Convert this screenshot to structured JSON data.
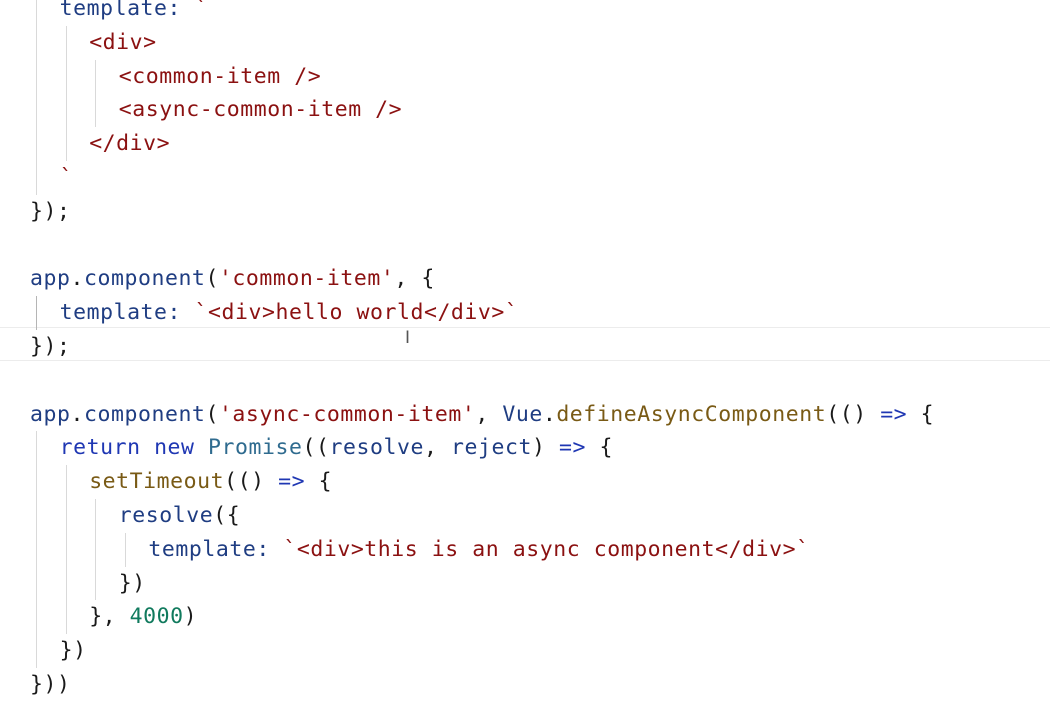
{
  "editor": {
    "language": "javascript",
    "lines": [
      {
        "indent": 1,
        "tokens": [
          {
            "t": "template: ",
            "k": "prop"
          },
          {
            "t": "`",
            "k": "str"
          }
        ]
      },
      {
        "indent": 2,
        "tokens": [
          {
            "t": "<div>",
            "k": "tag"
          }
        ]
      },
      {
        "indent": 3,
        "tokens": [
          {
            "t": "<common-item />",
            "k": "tag"
          }
        ]
      },
      {
        "indent": 3,
        "tokens": [
          {
            "t": "<async-common-item />",
            "k": "tag"
          }
        ]
      },
      {
        "indent": 2,
        "tokens": [
          {
            "t": "</div>",
            "k": "tag"
          }
        ]
      },
      {
        "indent": 1,
        "tokens": [
          {
            "t": "`",
            "k": "str"
          }
        ]
      },
      {
        "indent": 0,
        "tokens": [
          {
            "t": "});",
            "k": "punc"
          }
        ]
      },
      {
        "indent": 0,
        "tokens": []
      },
      {
        "indent": 0,
        "tokens": [
          {
            "t": "app",
            "k": "prop"
          },
          {
            "t": ".",
            "k": "punc"
          },
          {
            "t": "component",
            "k": "prop"
          },
          {
            "t": "(",
            "k": "punc"
          },
          {
            "t": "'common-item'",
            "k": "str"
          },
          {
            "t": ", {",
            "k": "punc"
          }
        ]
      },
      {
        "indent": 1,
        "tokens": [
          {
            "t": "template: ",
            "k": "prop"
          },
          {
            "t": "`<div>hello world</div>`",
            "k": "str"
          }
        ]
      },
      {
        "indent": 0,
        "tokens": [
          {
            "t": "});",
            "k": "punc"
          }
        ]
      },
      {
        "indent": 0,
        "tokens": []
      },
      {
        "indent": 0,
        "tokens": [
          {
            "t": "app",
            "k": "prop"
          },
          {
            "t": ".",
            "k": "punc"
          },
          {
            "t": "component",
            "k": "prop"
          },
          {
            "t": "(",
            "k": "punc"
          },
          {
            "t": "'async-common-item'",
            "k": "str"
          },
          {
            "t": ", ",
            "k": "punc"
          },
          {
            "t": "Vue",
            "k": "prop"
          },
          {
            "t": ".",
            "k": "punc"
          },
          {
            "t": "defineAsyncComponent",
            "k": "fn"
          },
          {
            "t": "(() ",
            "k": "punc"
          },
          {
            "t": "=>",
            "k": "kw"
          },
          {
            "t": " {",
            "k": "punc"
          }
        ]
      },
      {
        "indent": 1,
        "tokens": [
          {
            "t": "return",
            "k": "kw"
          },
          {
            "t": " ",
            "k": "punc"
          },
          {
            "t": "new",
            "k": "kw"
          },
          {
            "t": " ",
            "k": "punc"
          },
          {
            "t": "Promise",
            "k": "class"
          },
          {
            "t": "((",
            "k": "punc"
          },
          {
            "t": "resolve",
            "k": "prop"
          },
          {
            "t": ", ",
            "k": "punc"
          },
          {
            "t": "reject",
            "k": "prop"
          },
          {
            "t": ") ",
            "k": "punc"
          },
          {
            "t": "=>",
            "k": "kw"
          },
          {
            "t": " {",
            "k": "punc"
          }
        ]
      },
      {
        "indent": 2,
        "tokens": [
          {
            "t": "setTimeout",
            "k": "fn"
          },
          {
            "t": "(() ",
            "k": "punc"
          },
          {
            "t": "=>",
            "k": "kw"
          },
          {
            "t": " {",
            "k": "punc"
          }
        ]
      },
      {
        "indent": 3,
        "tokens": [
          {
            "t": "resolve",
            "k": "prop"
          },
          {
            "t": "({",
            "k": "punc"
          }
        ]
      },
      {
        "indent": 4,
        "tokens": [
          {
            "t": "template: ",
            "k": "prop"
          },
          {
            "t": "`<div>this is an async component</div>`",
            "k": "str"
          }
        ]
      },
      {
        "indent": 3,
        "tokens": [
          {
            "t": "})",
            "k": "punc"
          }
        ]
      },
      {
        "indent": 2,
        "tokens": [
          {
            "t": "}, ",
            "k": "punc"
          },
          {
            "t": "4000",
            "k": "num"
          },
          {
            "t": ")",
            "k": "punc"
          }
        ]
      },
      {
        "indent": 1,
        "tokens": [
          {
            "t": "})",
            "k": "punc"
          }
        ]
      },
      {
        "indent": 0,
        "tokens": [
          {
            "t": "}))",
            "k": "punc"
          }
        ]
      }
    ]
  }
}
